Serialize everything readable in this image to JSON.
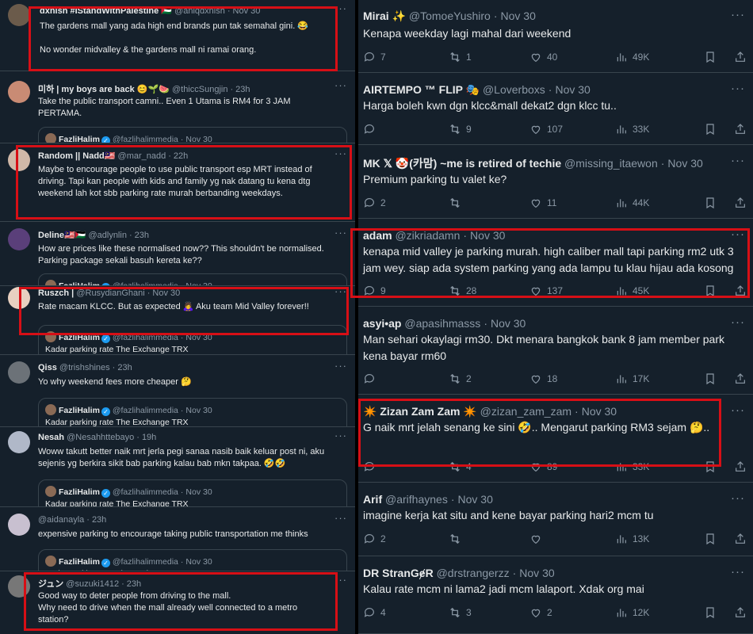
{
  "left": {
    "tweets": [
      {
        "name": "dxnish #IStandWithPalestine 🇵🇸",
        "handle": "@aniqdxnish",
        "date": "Nov 30",
        "lines": [
          "The gardens mall yang ada high end brands pun tak semahal gini. 😂",
          "",
          "No wonder midvalley & the gardens mall ni ramai orang."
        ]
      },
      {
        "name": "미하 | my boys are back 😊🌱🍉",
        "handle": "@thiccSungjin",
        "date": "23h",
        "lines": [
          "Take the public transport camni.. Even 1 Utama is RM4 for 3 JAM",
          "PERTAMA."
        ]
      },
      {
        "name": "Random || Nadd🇲🇾",
        "handle": "@mar_nadd",
        "date": "22h",
        "lines": [
          "Maybe to encourage people to use public transport esp MRT instead of",
          "driving. Tapi kan people with kids and family yg nak datang tu kena dtg",
          "weekend lah kot sbb parking rate murah berbanding weekdays."
        ]
      },
      {
        "name": "Deline🇲🇾🇵🇸",
        "handle": "@adlynlin",
        "date": "23h",
        "lines": [
          "How are prices like these normalised now?? This shouldn't be normalised.",
          "Parking package sekali basuh kereta ke??"
        ]
      },
      {
        "name": "Ruszch |",
        "handle": "@RusydianGhani",
        "date": "Nov 30",
        "lines": [
          "Rate macam KLCC. But as expected 🙇‍♀️ Aku team Mid Valley forever!!"
        ]
      },
      {
        "name": "Qiss",
        "handle": "@trishshines",
        "date": "23h",
        "lines": [
          "Yo why weekend fees more cheaper 🤔"
        ]
      },
      {
        "name": "Nesah",
        "handle": "@Nesahhttebayo",
        "date": "19h",
        "lines": [
          "Woww takutt better naik mrt jerla pegi sanaa nasib baik keluar post ni, aku",
          "sejenis yg berkira sikit bab parking kalau bab mkn takpaa. 🤣🤣"
        ]
      },
      {
        "name": "",
        "handle": "@aidanayla",
        "date": "23h",
        "lines": [
          "expensive parking to encourage taking public transportation me thinks"
        ]
      },
      {
        "name": "ジュン",
        "handle": "@suzuki1412",
        "date": "23h",
        "lines": [
          "Good way to deter people from driving to the mall.",
          "Why need to drive when the mall already well connected to a metro",
          "station?"
        ]
      }
    ],
    "quote": {
      "name": "FazliHalim",
      "handle": "@fazlihalimmedia",
      "date": "Nov 30",
      "text": "Kadar parking rate The Exchange TRX"
    }
  },
  "right": {
    "tweets": [
      {
        "name": "Mirai ✨",
        "handle": "@TomoeYushiro",
        "date": "Nov 30",
        "text": "Kenapa weekday lagi mahal dari weekend",
        "replies": "7",
        "retweets": "1",
        "likes": "40",
        "views": "49K"
      },
      {
        "name": "AIRTEMPO ™ FLIP 🎭",
        "handle": "@Loverboxs",
        "date": "Nov 30",
        "text": "Harga boleh kwn dgn klcc&mall dekat2 dgn klcc tu..",
        "replies": "",
        "retweets": "9",
        "likes": "107",
        "views": "33K"
      },
      {
        "name": "MK 𝕏 🤡(카맘) ~me is retired of techie",
        "handle": "@missing_itaewon",
        "date": "Nov 30",
        "text": "Premium parking tu valet ke?",
        "replies": "2",
        "retweets": "",
        "likes": "11",
        "views": "44K"
      },
      {
        "name": "adam",
        "handle": "@zikriadamn",
        "date": "Nov 30",
        "text": "kenapa mid valley je parking murah. high caliber mall tapi parking rm2 utk 3 jam wey. siap ada system parking yang ada lampu tu klau hijau ada kosong",
        "replies": "9",
        "retweets": "28",
        "likes": "137",
        "views": "45K"
      },
      {
        "name": "asyi•ap",
        "handle": "@apasihmasss",
        "date": "Nov 30",
        "text": "Man sehari okaylagi rm30. Dkt menara bangkok bank 8 jam member park kena bayar rm60",
        "replies": "",
        "retweets": "2",
        "likes": "18",
        "views": "17K"
      },
      {
        "name": "✴️ Zizan Zam Zam ✴️",
        "handle": "@zizan_zam_zam",
        "date": "Nov 30",
        "text": "G naik mrt jelah senang ke sini 🤣.. Mengarut parking RM3 sejam 🤔..",
        "replies": "",
        "retweets": "4",
        "likes": "89",
        "views": "33K"
      },
      {
        "name": "Arif",
        "handle": "@arifhaynes",
        "date": "Nov 30",
        "text": "imagine kerja kat situ and kene bayar parking hari2 mcm tu",
        "replies": "2",
        "retweets": "",
        "likes": "",
        "views": "13K"
      },
      {
        "name": "DR StranGɇR",
        "handle": "@drstrangerzz",
        "date": "Nov 30",
        "text": "Kalau rate mcm ni lama2 jadi mcm lalaport. Xdak org mai",
        "replies": "4",
        "retweets": "3",
        "likes": "2",
        "views": "12K"
      }
    ]
  },
  "ui": {
    "more": "···",
    "dot": "·",
    "verified": "✓"
  },
  "colors": {
    "bg": "#15202b",
    "border": "#38444d",
    "muted": "#8b98a5",
    "accent": "#1d9bf0",
    "highlight": "#d70f16"
  }
}
